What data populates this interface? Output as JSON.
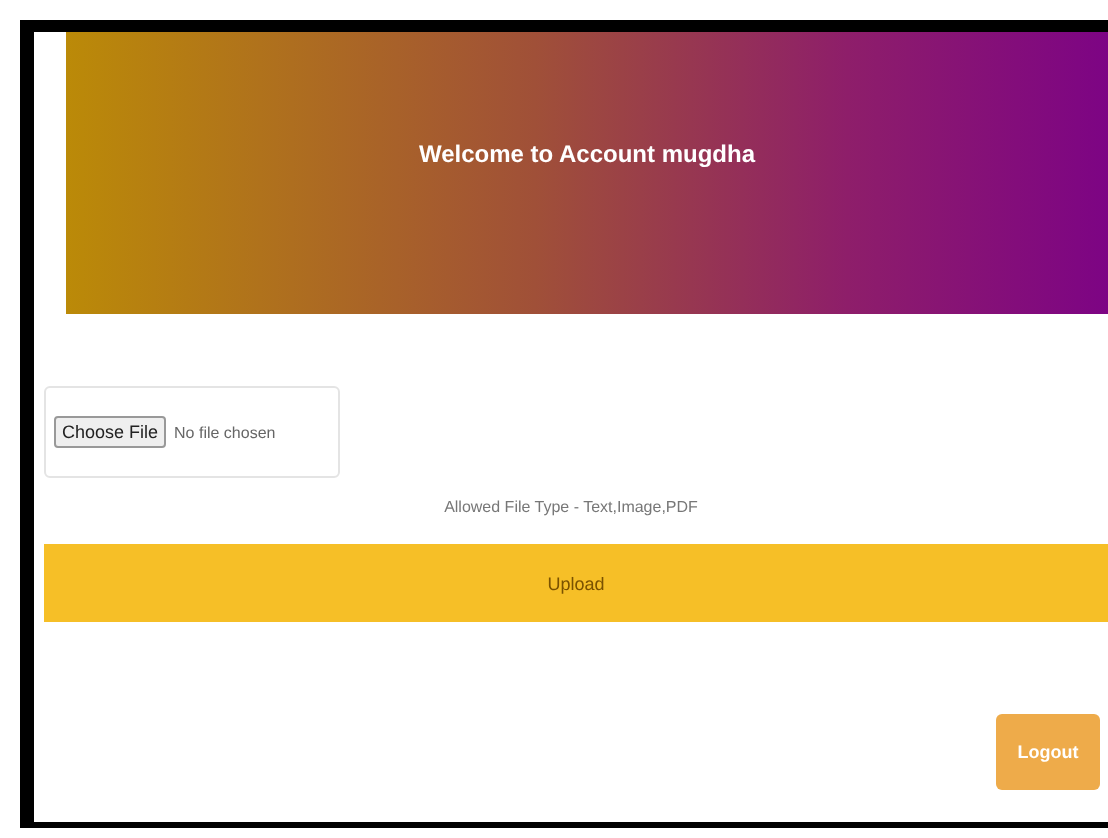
{
  "header": {
    "title": "Welcome to Account mugdha"
  },
  "file_input": {
    "button": "Choose File",
    "status": "No file chosen"
  },
  "hint": "Allowed File Type - Text,Image,PDF",
  "upload_button": "Upload",
  "logout_button": "Logout"
}
